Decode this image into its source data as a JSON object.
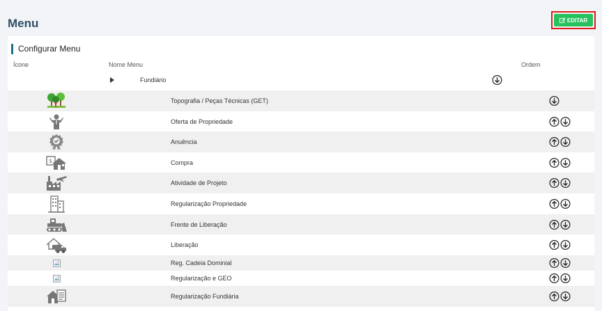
{
  "header": {
    "title": "Menu",
    "edit_label": "EDITAR"
  },
  "card": {
    "title": "Configurar Menu"
  },
  "columns": {
    "icone": "Ícone",
    "nome": "Nome Menu",
    "ordem": "Ordem"
  },
  "group": {
    "label": "Fundiário",
    "arrows": [
      "down"
    ]
  },
  "items": [
    {
      "label": "Topografia / Peças Técnicas (GET)",
      "icon": "trees-figure-icon",
      "arrows": [
        "down"
      ]
    },
    {
      "label": "Oferta de Propriedade",
      "icon": "businessman-icon",
      "arrows": [
        "up",
        "down"
      ]
    },
    {
      "label": "Anuência",
      "icon": "award-badge-icon",
      "arrows": [
        "up",
        "down"
      ]
    },
    {
      "label": "Compra",
      "icon": "house-money-icon",
      "arrows": [
        "up",
        "down"
      ]
    },
    {
      "label": "Atividade de Projeto",
      "icon": "factory-plane-icon",
      "arrows": [
        "up",
        "down"
      ]
    },
    {
      "label": "Regularização Propriedade",
      "icon": "buildings-icon",
      "arrows": [
        "up",
        "down"
      ]
    },
    {
      "label": "Frente de Liberação",
      "icon": "bulldozer-icon",
      "arrows": [
        "up",
        "down"
      ]
    },
    {
      "label": "Liberação",
      "icon": "house-truck-icon",
      "arrows": [
        "up",
        "down"
      ]
    },
    {
      "label": "Reg. Cadeia Dominial",
      "icon": "broken-image-icon",
      "arrows": [
        "up",
        "down"
      ]
    },
    {
      "label": "Regularização e GEO",
      "icon": "broken-image-icon",
      "arrows": [
        "up",
        "down"
      ]
    },
    {
      "label": "Regularização Fundiária",
      "icon": "house-document-icon",
      "arrows": [
        "up",
        "down"
      ]
    }
  ],
  "colors": {
    "title": "#2d5166",
    "accent": "#1e6f86",
    "button": "#27c25f",
    "highlight": "#e01b1b"
  }
}
